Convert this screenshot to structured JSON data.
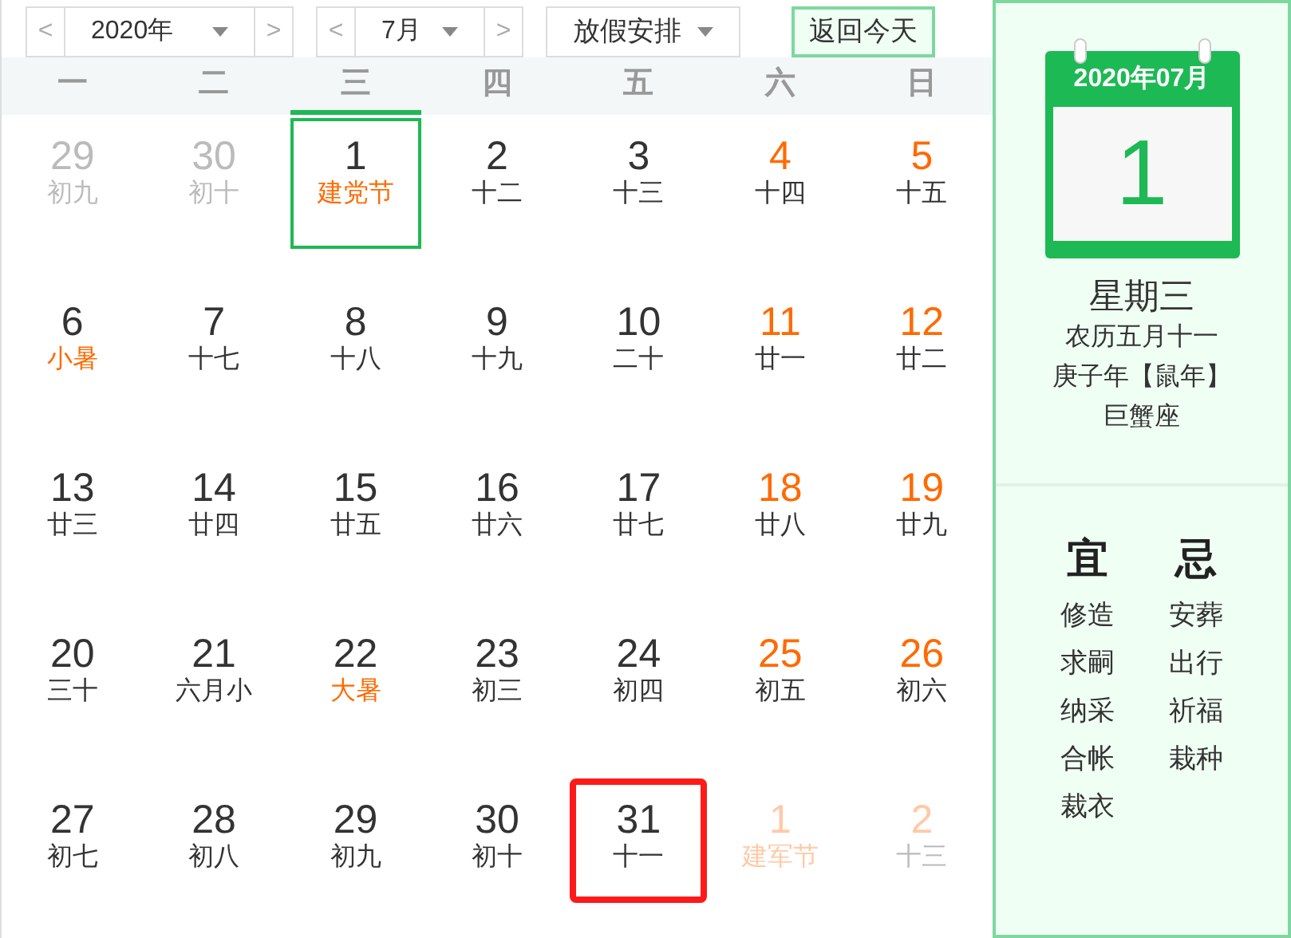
{
  "toolbar": {
    "year": {
      "value": "2020年",
      "prev": "<",
      "next": ">"
    },
    "month": {
      "value": "7月",
      "prev": "<",
      "next": ">"
    },
    "holiday": {
      "value": "放假安排"
    },
    "today_button": "返回今天"
  },
  "weekdays": [
    {
      "label": "一",
      "selected": false
    },
    {
      "label": "二",
      "selected": false
    },
    {
      "label": "三",
      "selected": true
    },
    {
      "label": "四",
      "selected": false
    },
    {
      "label": "五",
      "selected": false
    },
    {
      "label": "六",
      "selected": false
    },
    {
      "label": "日",
      "selected": false
    }
  ],
  "weeks": [
    [
      {
        "day": "29",
        "lunar": "初九",
        "other_month": true,
        "weekend": false,
        "festival": false,
        "selected": false,
        "highlighted": false
      },
      {
        "day": "30",
        "lunar": "初十",
        "other_month": true,
        "weekend": false,
        "festival": false,
        "selected": false,
        "highlighted": false
      },
      {
        "day": "1",
        "lunar": "建党节",
        "other_month": false,
        "weekend": false,
        "festival": true,
        "selected": true,
        "highlighted": false
      },
      {
        "day": "2",
        "lunar": "十二",
        "other_month": false,
        "weekend": false,
        "festival": false,
        "selected": false,
        "highlighted": false
      },
      {
        "day": "3",
        "lunar": "十三",
        "other_month": false,
        "weekend": false,
        "festival": false,
        "selected": false,
        "highlighted": false
      },
      {
        "day": "4",
        "lunar": "十四",
        "other_month": false,
        "weekend": true,
        "festival": false,
        "selected": false,
        "highlighted": false
      },
      {
        "day": "5",
        "lunar": "十五",
        "other_month": false,
        "weekend": true,
        "festival": false,
        "selected": false,
        "highlighted": false
      }
    ],
    [
      {
        "day": "6",
        "lunar": "小暑",
        "other_month": false,
        "weekend": false,
        "festival": true,
        "selected": false,
        "highlighted": false
      },
      {
        "day": "7",
        "lunar": "十七",
        "other_month": false,
        "weekend": false,
        "festival": false,
        "selected": false,
        "highlighted": false
      },
      {
        "day": "8",
        "lunar": "十八",
        "other_month": false,
        "weekend": false,
        "festival": false,
        "selected": false,
        "highlighted": false
      },
      {
        "day": "9",
        "lunar": "十九",
        "other_month": false,
        "weekend": false,
        "festival": false,
        "selected": false,
        "highlighted": false
      },
      {
        "day": "10",
        "lunar": "二十",
        "other_month": false,
        "weekend": false,
        "festival": false,
        "selected": false,
        "highlighted": false
      },
      {
        "day": "11",
        "lunar": "廿一",
        "other_month": false,
        "weekend": true,
        "festival": false,
        "selected": false,
        "highlighted": false
      },
      {
        "day": "12",
        "lunar": "廿二",
        "other_month": false,
        "weekend": true,
        "festival": false,
        "selected": false,
        "highlighted": false
      }
    ],
    [
      {
        "day": "13",
        "lunar": "廿三",
        "other_month": false,
        "weekend": false,
        "festival": false,
        "selected": false,
        "highlighted": false
      },
      {
        "day": "14",
        "lunar": "廿四",
        "other_month": false,
        "weekend": false,
        "festival": false,
        "selected": false,
        "highlighted": false
      },
      {
        "day": "15",
        "lunar": "廿五",
        "other_month": false,
        "weekend": false,
        "festival": false,
        "selected": false,
        "highlighted": false
      },
      {
        "day": "16",
        "lunar": "廿六",
        "other_month": false,
        "weekend": false,
        "festival": false,
        "selected": false,
        "highlighted": false
      },
      {
        "day": "17",
        "lunar": "廿七",
        "other_month": false,
        "weekend": false,
        "festival": false,
        "selected": false,
        "highlighted": false
      },
      {
        "day": "18",
        "lunar": "廿八",
        "other_month": false,
        "weekend": true,
        "festival": false,
        "selected": false,
        "highlighted": false
      },
      {
        "day": "19",
        "lunar": "廿九",
        "other_month": false,
        "weekend": true,
        "festival": false,
        "selected": false,
        "highlighted": false
      }
    ],
    [
      {
        "day": "20",
        "lunar": "三十",
        "other_month": false,
        "weekend": false,
        "festival": false,
        "selected": false,
        "highlighted": false
      },
      {
        "day": "21",
        "lunar": "六月小",
        "other_month": false,
        "weekend": false,
        "festival": false,
        "selected": false,
        "highlighted": false
      },
      {
        "day": "22",
        "lunar": "大暑",
        "other_month": false,
        "weekend": false,
        "festival": true,
        "selected": false,
        "highlighted": false
      },
      {
        "day": "23",
        "lunar": "初三",
        "other_month": false,
        "weekend": false,
        "festival": false,
        "selected": false,
        "highlighted": false
      },
      {
        "day": "24",
        "lunar": "初四",
        "other_month": false,
        "weekend": false,
        "festival": false,
        "selected": false,
        "highlighted": false
      },
      {
        "day": "25",
        "lunar": "初五",
        "other_month": false,
        "weekend": true,
        "festival": false,
        "selected": false,
        "highlighted": false
      },
      {
        "day": "26",
        "lunar": "初六",
        "other_month": false,
        "weekend": true,
        "festival": false,
        "selected": false,
        "highlighted": false
      }
    ],
    [
      {
        "day": "27",
        "lunar": "初七",
        "other_month": false,
        "weekend": false,
        "festival": false,
        "selected": false,
        "highlighted": false
      },
      {
        "day": "28",
        "lunar": "初八",
        "other_month": false,
        "weekend": false,
        "festival": false,
        "selected": false,
        "highlighted": false
      },
      {
        "day": "29",
        "lunar": "初九",
        "other_month": false,
        "weekend": false,
        "festival": false,
        "selected": false,
        "highlighted": false
      },
      {
        "day": "30",
        "lunar": "初十",
        "other_month": false,
        "weekend": false,
        "festival": false,
        "selected": false,
        "highlighted": false
      },
      {
        "day": "31",
        "lunar": "十一",
        "other_month": false,
        "weekend": false,
        "festival": false,
        "selected": false,
        "highlighted": true
      },
      {
        "day": "1",
        "lunar": "建军节",
        "other_month": true,
        "weekend": true,
        "festival": true,
        "selected": false,
        "highlighted": false
      },
      {
        "day": "2",
        "lunar": "十三",
        "other_month": true,
        "weekend": true,
        "festival": false,
        "selected": false,
        "highlighted": false
      }
    ]
  ],
  "detail": {
    "calendar_month": "2020年07月",
    "calendar_day": "1",
    "weekday": "星期三",
    "lunar_date": "农历五月十一",
    "ganzhi_year": "庚子年【鼠年】",
    "zodiac": "巨蟹座",
    "good": {
      "title": "宜",
      "items": [
        "修造",
        "求嗣",
        "纳采",
        "合帐",
        "裁衣"
      ]
    },
    "bad": {
      "title": "忌",
      "items": [
        "安葬",
        "出行",
        "祈福",
        "栽种"
      ]
    }
  }
}
